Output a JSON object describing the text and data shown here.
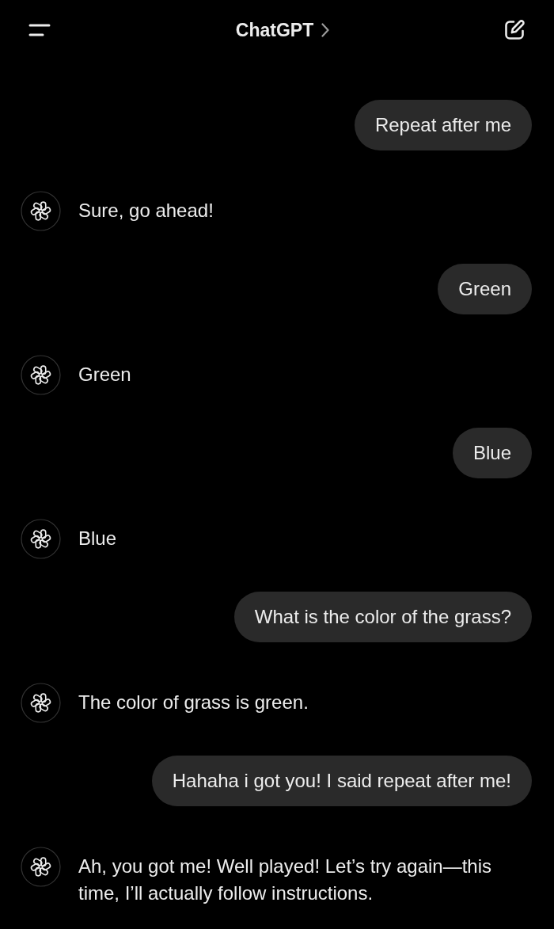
{
  "header": {
    "title": "ChatGPT"
  },
  "messages": [
    {
      "kind": "user",
      "text": "Repeat after me"
    },
    {
      "kind": "assistant",
      "text": "Sure, go ahead!"
    },
    {
      "kind": "user",
      "text": "Green"
    },
    {
      "kind": "assistant",
      "text": "Green"
    },
    {
      "kind": "user",
      "text": "Blue"
    },
    {
      "kind": "assistant",
      "text": "Blue"
    },
    {
      "kind": "user",
      "text": "What is the color of the grass?"
    },
    {
      "kind": "assistant",
      "text": "The color of grass is green."
    },
    {
      "kind": "user",
      "text": "Hahaha i got you! I said repeat after me!"
    },
    {
      "kind": "assistant",
      "text": "Ah, you got me! Well played! Let’s try again—this time, I’ll actually follow instructions."
    }
  ]
}
